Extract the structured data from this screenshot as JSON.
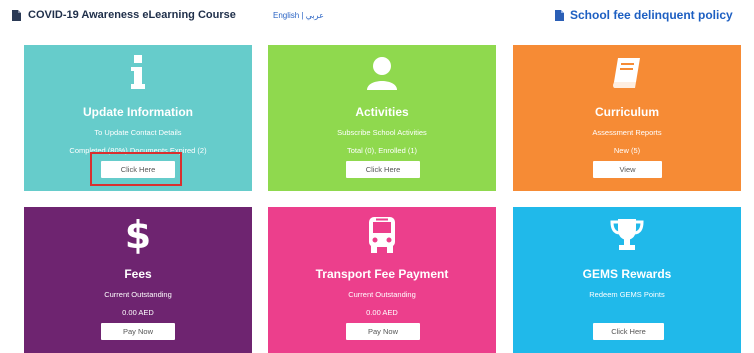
{
  "header": {
    "course_link": "COVID-19 Awareness eLearning Course",
    "lang_link": "English | عربي",
    "policy_link": "School fee delinquent policy"
  },
  "cards": [
    {
      "icon": "info-icon",
      "title": "Update Information",
      "sub1": "To Update Contact Details",
      "sub2": "Completed (80%) Documents Expired (2)",
      "button": "Click Here",
      "color": "#66cccb"
    },
    {
      "icon": "user-icon",
      "title": "Activities",
      "sub1": "Subscribe School Activities",
      "sub2": "Total (0), Enrolled (1)",
      "button": "Click Here",
      "color": "#8fd94e"
    },
    {
      "icon": "book-icon",
      "title": "Curriculum",
      "sub1": "Assessment Reports",
      "sub2": "New (5)",
      "button": "View",
      "color": "#f68b35"
    },
    {
      "icon": "dollar-icon",
      "title": "Fees",
      "sub1": "Current Outstanding",
      "sub2": "0.00 AED",
      "button": "Pay Now",
      "color": "#6e2470"
    },
    {
      "icon": "bus-icon",
      "title": "Transport Fee Payment",
      "sub1": "Current Outstanding",
      "sub2": "0.00 AED",
      "button": "Pay Now",
      "color": "#ec3f8c"
    },
    {
      "icon": "trophy-icon",
      "title": "GEMS Rewards",
      "sub1": "Redeem GEMS Points",
      "sub2": "",
      "button": "Click Here",
      "color": "#20b9ea"
    }
  ]
}
